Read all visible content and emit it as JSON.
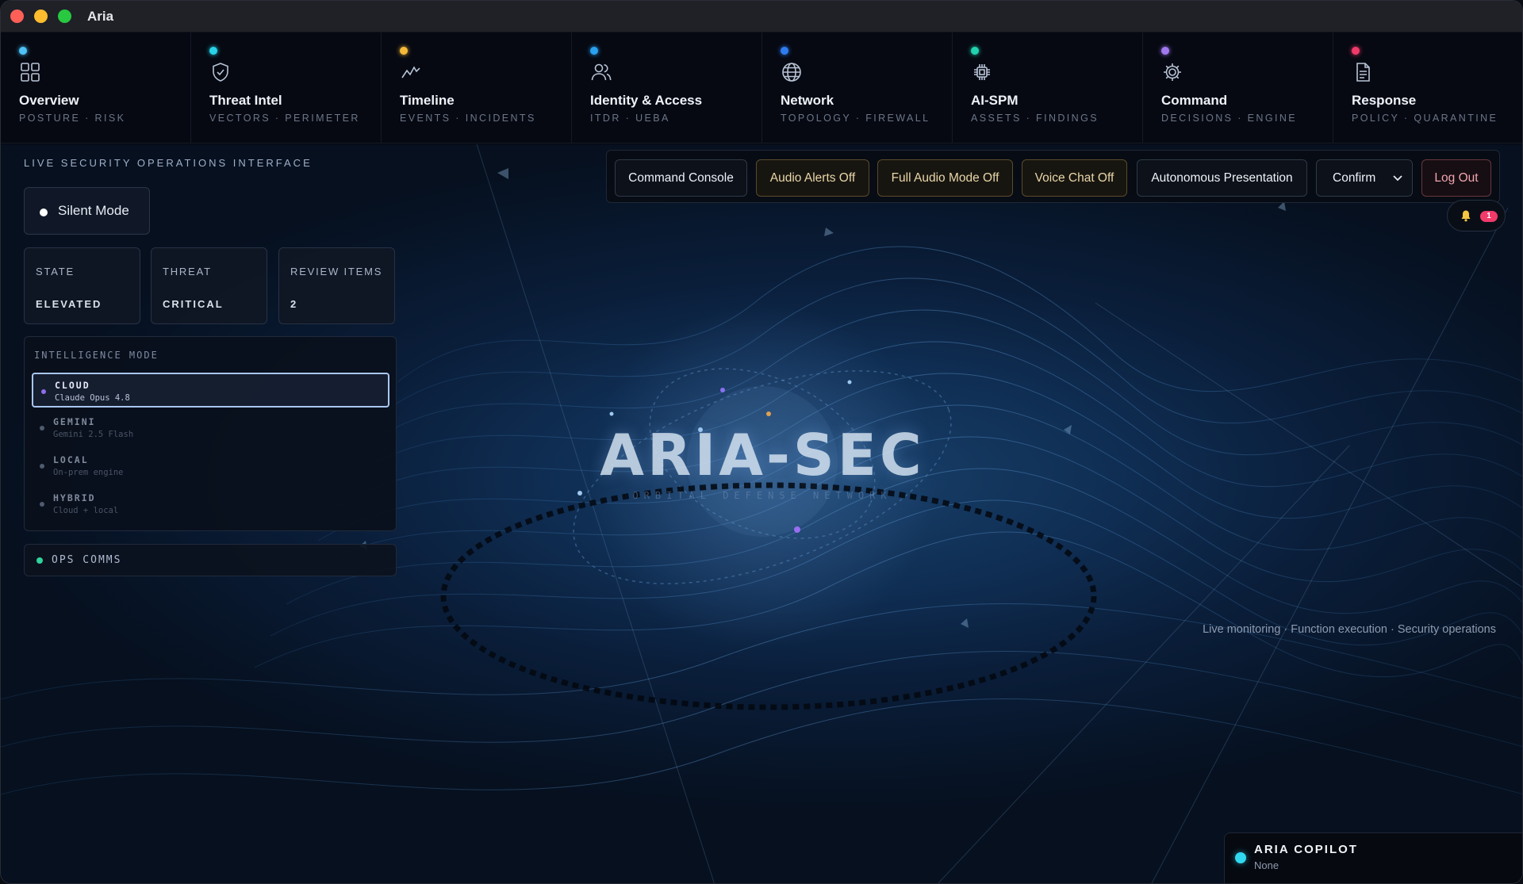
{
  "window": {
    "title": "Aria"
  },
  "nav": [
    {
      "title": "Overview",
      "subtitle": "POSTURE · RISK",
      "dot_color": "#4fc3f7",
      "icon": "grid-icon"
    },
    {
      "title": "Threat Intel",
      "subtitle": "VECTORS · PERIMETER",
      "dot_color": "#29d3e8",
      "icon": "shield-icon"
    },
    {
      "title": "Timeline",
      "subtitle": "EVENTS · INCIDENTS",
      "dot_color": "#f5b93a",
      "icon": "activity-icon"
    },
    {
      "title": "Identity & Access",
      "subtitle": "ITDR · UEBA",
      "dot_color": "#2aa0f0",
      "icon": "users-icon"
    },
    {
      "title": "Network",
      "subtitle": "TOPOLOGY · FIREWALL",
      "dot_color": "#2f7cf0",
      "icon": "globe-icon"
    },
    {
      "title": "AI-SPM",
      "subtitle": "ASSETS · FINDINGS",
      "dot_color": "#22d3b0",
      "icon": "chip-icon"
    },
    {
      "title": "Command",
      "subtitle": "DECISIONS · ENGINE",
      "dot_color": "#a078f0",
      "icon": "gear-icon"
    },
    {
      "title": "Response",
      "subtitle": "POLICY · QUARANTINE",
      "dot_color": "#f03a6a",
      "icon": "document-icon"
    }
  ],
  "live_label": "LIVE SECURITY OPERATIONS INTERFACE",
  "silent_mode": {
    "label": "Silent Mode"
  },
  "stats": [
    {
      "key": "STATE",
      "value": "ELEVATED"
    },
    {
      "key": "THREAT",
      "value": "CRITICAL"
    },
    {
      "key": "REVIEW ITEMS",
      "value": "2"
    }
  ],
  "intelligence": {
    "title": "INTELLIGENCE MODE",
    "modes": [
      {
        "name": "CLOUD",
        "desc": "Claude Opus 4.8",
        "active": true
      },
      {
        "name": "GEMINI",
        "desc": "Gemini 2.5 Flash",
        "active": false
      },
      {
        "name": "LOCAL",
        "desc": "On-prem engine",
        "active": false
      },
      {
        "name": "HYBRID",
        "desc": "Cloud + local",
        "active": false
      }
    ]
  },
  "ops_comms": {
    "label": "OPS COMMS"
  },
  "toolbar": {
    "command_console": "Command Console",
    "audio_alerts": "Audio Alerts Off",
    "full_audio": "Full Audio Mode Off",
    "voice_chat": "Voice Chat Off",
    "autonomous": "Autonomous Presentation",
    "confirm": "Confirm",
    "logout": "Log Out"
  },
  "notifications": {
    "count": "1"
  },
  "hero": {
    "title": "ARIA-SEC",
    "subtitle": "ORBITAL DEFENSE NETWORK"
  },
  "footer_caption": "Live monitoring · Function execution · Security operations",
  "copilot": {
    "title": "ARIA COPILOT",
    "status": "None"
  },
  "colors": {
    "accent": "#32d8f0",
    "warn_border": "#5a4a2a",
    "danger": "#f03a6a"
  }
}
